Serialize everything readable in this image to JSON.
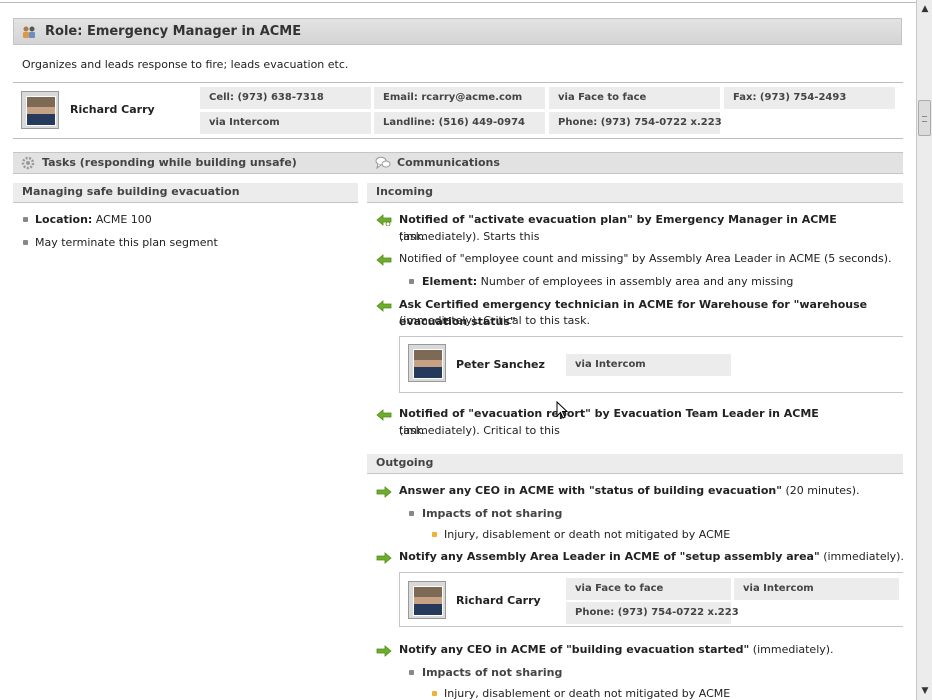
{
  "role": {
    "title": "Role: Emergency Manager in ACME",
    "description": "Organizes and leads response to fire; leads evacuation etc."
  },
  "contact": {
    "name": "Richard Carry",
    "cells": {
      "cell": "Cell: (973) 638-7318",
      "email": "Email: rcarry@acme.com",
      "face": "via Face to face",
      "fax": "Fax: (973) 754-2493",
      "intercom": "via Intercom",
      "landline": "Landline: (516) 449-0974",
      "phone": "Phone: (973) 754-0722 x.223"
    }
  },
  "tasks": {
    "header": "Tasks (responding while building unsafe)",
    "subheader": "Managing safe building evacuation",
    "location_label": "Location:",
    "location_value": "ACME 100",
    "terminate": "May terminate this plan segment"
  },
  "communications": {
    "header": "Communications",
    "incoming_label": "Incoming",
    "outgoing_label": "Outgoing",
    "in1": {
      "bold": "Notified of \"activate evacuation plan\" by Emergency Manager in ACME",
      "rest": " (immediately). Starts this",
      "line2": "task."
    },
    "in2": {
      "text": "Notified of \"employee count and missing\" by Assembly Area Leader in ACME (5 seconds).",
      "element_label": "Element:",
      "element_value": "Number of employees in assembly area and any missing"
    },
    "in3": {
      "bold": "Ask Certified emergency technician in ACME for Warehouse for \"warehouse evacuation status\"",
      "line2": "(immediately). Critical to this task.",
      "person": "Peter Sanchez",
      "channel": "via Intercom"
    },
    "in4": {
      "bold": "Notified of \"evacuation report\" by Evacuation Team Leader in ACME",
      "rest": " (immediately). Critical to this",
      "line2": "task."
    },
    "out1": {
      "bold": "Answer any CEO in ACME with \"status of building evacuation\"",
      "rest": " (20 minutes).",
      "impacts": "Impacts of not sharing",
      "impact_item": "Injury, disablement or death not mitigated by ACME"
    },
    "out2": {
      "bold": "Notify any Assembly Area Leader in ACME of \"setup assembly area\"",
      "rest": " (immediately).",
      "person": "Richard Carry",
      "face": "via Face to face",
      "intercom": "via Intercom",
      "phone": "Phone: (973) 754-0722 x.223"
    },
    "out3": {
      "bold": "Notify any CEO in ACME of \"building evacuation started\"",
      "rest": " (immediately).",
      "impacts": "Impacts of not sharing",
      "impact_item": "Injury, disablement or death not mitigated by ACME"
    }
  },
  "colors": {
    "arrow_green": "#6fae2c",
    "header_gray": "#e2e2e2",
    "bullet_orange": "#f2b134"
  },
  "icons": [
    "role-people-icon",
    "gear-icon",
    "speech-bubbles-icon",
    "incoming-arrow-icon",
    "outgoing-arrow-icon",
    "mouse-cursor-icon"
  ]
}
